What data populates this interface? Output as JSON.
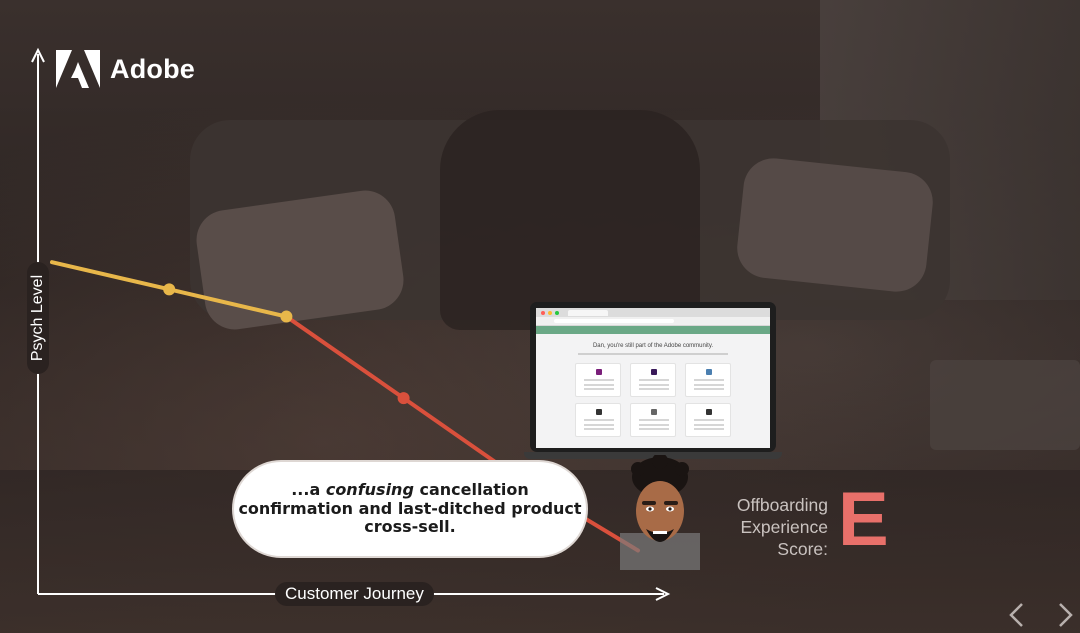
{
  "brand": {
    "name": "Adobe",
    "logo_icon": "adobe-logo-icon"
  },
  "chart_data": {
    "type": "line",
    "ylabel": "Psych Level",
    "xlabel": "Customer Journey",
    "series": [
      {
        "values": [
          {
            "x": 0,
            "y": 6.1
          },
          {
            "x": 1,
            "y": 5.6
          },
          {
            "x": 2,
            "y": 5.1
          }
        ],
        "color": "#e8b74a"
      },
      {
        "values": [
          {
            "x": 2,
            "y": 5.1
          },
          {
            "x": 3,
            "y": 3.6
          },
          {
            "x": 4,
            "y": 2.1
          },
          {
            "x": 5,
            "y": 0.8
          }
        ],
        "color": "#d9503c"
      }
    ],
    "markers": [
      {
        "x": 1,
        "y": 5.6,
        "color": "#e8b74a"
      },
      {
        "x": 2,
        "y": 5.1,
        "color": "#e8b74a"
      },
      {
        "x": 3,
        "y": 3.6,
        "color": "#d9503c"
      },
      {
        "x": 4,
        "y": 2.1,
        "color": "#d9503c"
      }
    ],
    "axis_color": "#ffffff",
    "grid": false
  },
  "laptop": {
    "page_heading": "Dan, you're still part of the Adobe community.",
    "cards": [
      {
        "icon_color": "#7a1f7a"
      },
      {
        "icon_color": "#3a1a5a"
      },
      {
        "icon_color": "#4b7fb0"
      },
      {
        "icon_color": "#333333"
      },
      {
        "icon_color": "#666666"
      },
      {
        "icon_color": "#333333"
      }
    ]
  },
  "callout": {
    "prefix": "...a ",
    "emphasis": "confusing",
    "suffix": " cancellation confirmation and last-ditched product cross-sell."
  },
  "score": {
    "label": "Offboarding Experience Score:",
    "value": "E",
    "color": "#e8706a"
  },
  "nav": {
    "prev_icon": "chevron-left-icon",
    "next_icon": "chevron-right-icon"
  },
  "avatar": {
    "icon": "bitmoji-avatar"
  }
}
